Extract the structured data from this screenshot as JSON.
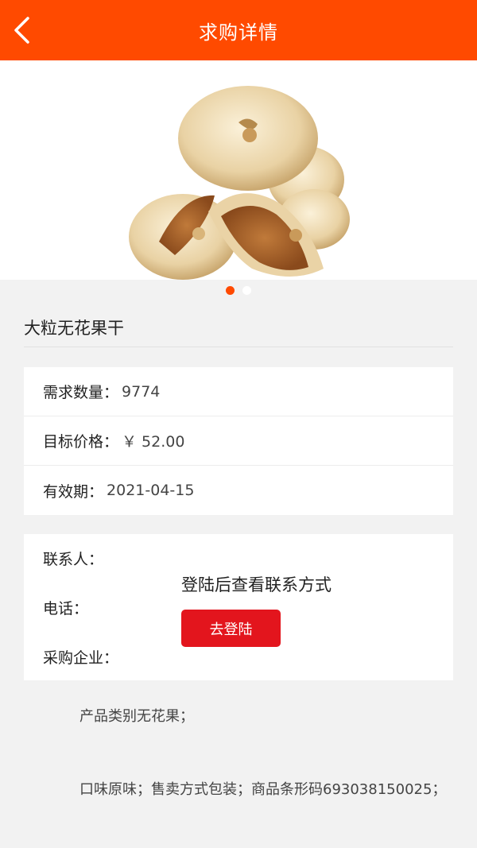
{
  "header": {
    "title": "求购详情",
    "back_icon": "chevron-left-icon"
  },
  "banner": {
    "image_alt": "dried figs",
    "dots": 2,
    "active_dot": 0
  },
  "product": {
    "title": "大粒无花果干"
  },
  "info": {
    "quantity_label": "需求数量：",
    "quantity_value": "9774",
    "price_label": "目标价格：",
    "price_value": "￥ 52.00",
    "validity_label": "有效期：",
    "validity_value": "2021-04-15"
  },
  "contact": {
    "person_label": "联系人：",
    "phone_label": "电话：",
    "company_label": "采购企业：",
    "login_hint": "登陆后查看联系方式",
    "login_button": "去登陆"
  },
  "description": {
    "line1": "产品类别无花果；",
    "line2": "口味原味；售卖方式包装；商品条形码693038150025；"
  },
  "colors": {
    "accent": "#ff4a00",
    "button": "#e3151d",
    "background": "#f2f2f2"
  }
}
